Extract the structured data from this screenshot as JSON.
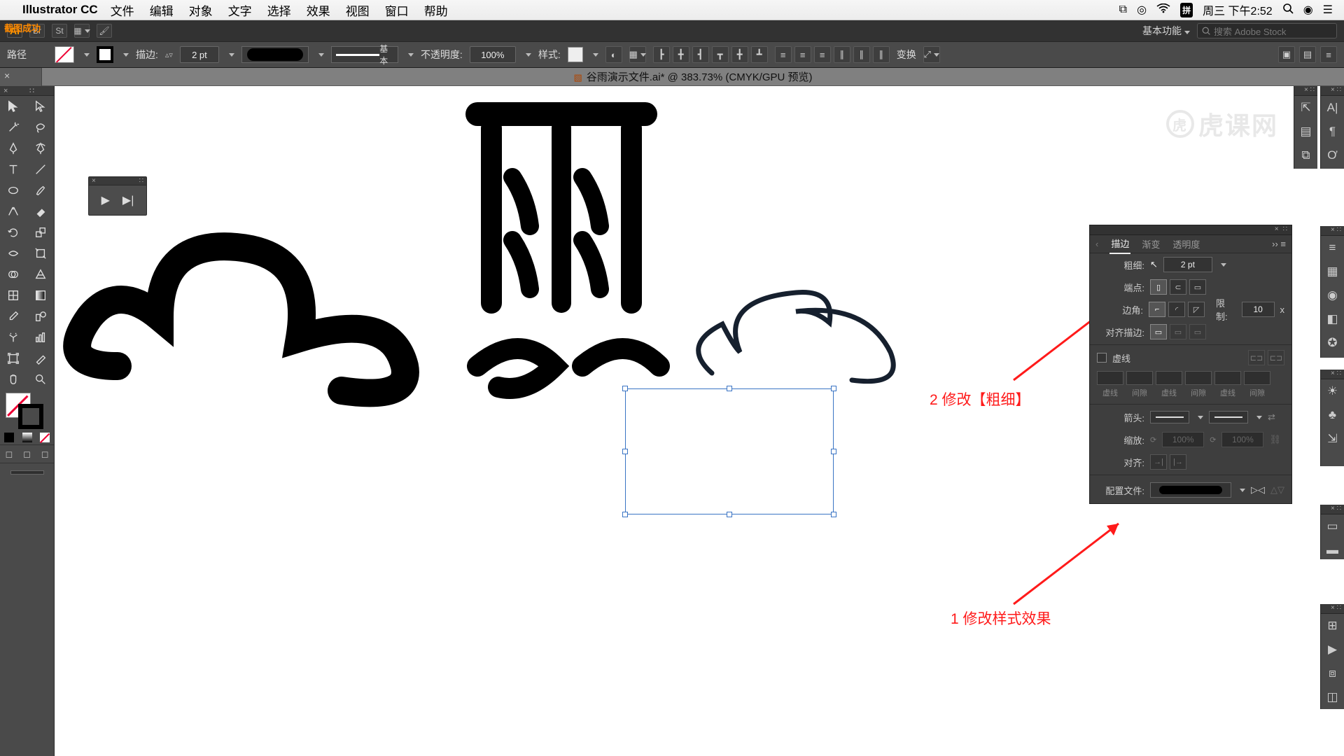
{
  "mac": {
    "app_name": "Illustrator CC",
    "menus": [
      "文件",
      "编辑",
      "对象",
      "文字",
      "选择",
      "效果",
      "视图",
      "窗口",
      "帮助"
    ],
    "status_time": "周三 下午2:52",
    "ime": "拼"
  },
  "orange_chip": "截图成功",
  "appbar": {
    "workspace": "基本功能",
    "search_placeholder": "搜索 Adobe Stock"
  },
  "control": {
    "path_label": "路径",
    "stroke_label": "描边:",
    "stroke_weight": "2 pt",
    "uniform_label": "基本",
    "opacity_label": "不透明度:",
    "opacity_value": "100%",
    "style_label": "样式:",
    "transform_label": "变换"
  },
  "doc": {
    "title": "谷雨演示文件.ai* @ 383.73% (CMYK/GPU 预览)"
  },
  "stroke_panel": {
    "tabs": [
      "描边",
      "渐变",
      "透明度"
    ],
    "weight_label": "粗细:",
    "weight_value": "2 pt",
    "cap_label": "端点:",
    "corner_label": "边角:",
    "limit_label": "限制:",
    "limit_value": "10",
    "limit_x": "x",
    "align_label": "对齐描边:",
    "dashed_label": "虚线",
    "dash_cols": [
      "虚线",
      "间隙",
      "虚线",
      "间隙",
      "虚线",
      "间隙"
    ],
    "arrow_label": "箭头:",
    "scale_label": "缩放:",
    "scale_v1": "100%",
    "scale_v2": "100%",
    "align_arrow_label": "对齐:",
    "profile_label": "配置文件:"
  },
  "annotations": {
    "a1": "1 修改样式效果",
    "a2": "2 修改【粗细】"
  },
  "watermark": "虎课网"
}
